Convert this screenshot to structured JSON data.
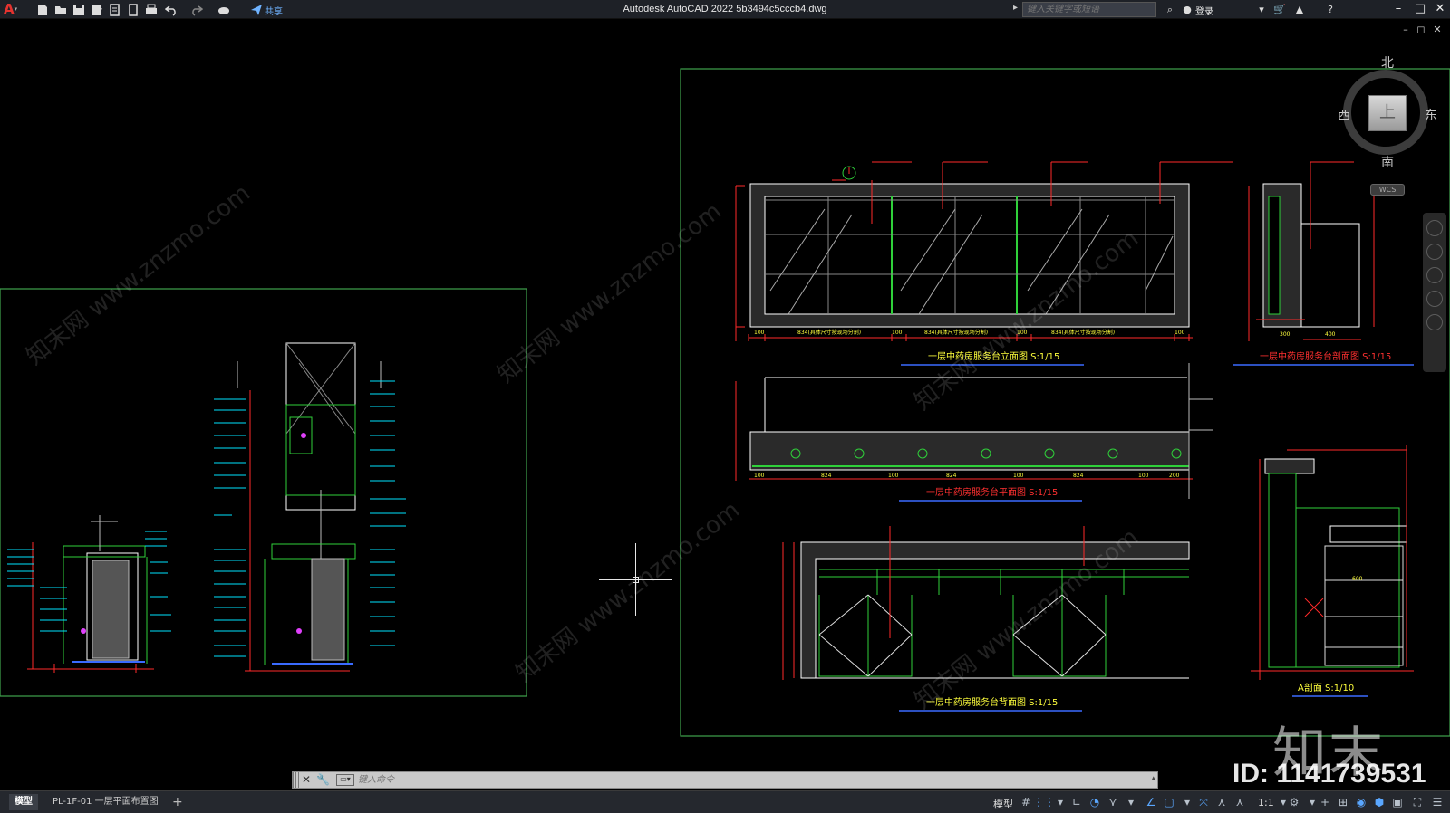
{
  "app": {
    "title": "Autodesk AutoCAD 2022    5b3494c5cccb4.dwg",
    "logo": "A",
    "share_label": "共享",
    "search_placeholder": "键入关键字或短语",
    "login_label": "登录"
  },
  "icons": {
    "qat": [
      "new-icon",
      "open-icon",
      "save-icon",
      "save-as-icon",
      "publish-icon",
      "plot-preview-icon",
      "plot-icon",
      "undo-icon",
      "redo-icon",
      "match-props-icon",
      "share-icon"
    ],
    "right": [
      "search-icon",
      "user-icon",
      "cart-icon",
      "autodesk-app-icon",
      "help-icon"
    ]
  },
  "viewcube": {
    "north": "北",
    "south": "南",
    "west": "西",
    "east": "东",
    "face": "上",
    "wcs": "WCS"
  },
  "drawing": {
    "titles": {
      "front_elevation": "一层中药房服务台立面图  S:1/15",
      "side_section": "一层中药房服务台剖面图  S:1/15",
      "plan": "一层中药房服务台平面图  S:1/15",
      "back_elevation": "一层中药房服务台背面图  S:1/15",
      "detail_a": "A剖面  S:1/10"
    },
    "dims": {
      "front_bottom": [
        "100",
        "834(具体尺寸按现场分割)",
        "100",
        "834(具体尺寸按现场分割)",
        "100",
        "834(具体尺寸按现场分割)",
        "100"
      ],
      "plan_bottom": [
        "100",
        "824",
        "100",
        "824",
        "100",
        "824",
        "100",
        "200"
      ],
      "side_bottom": [
        "300",
        "400"
      ],
      "detail_total": "600"
    },
    "colors": {
      "frame": "#3fa34d",
      "outline": "#ffffff",
      "dim": "#ff2a2a",
      "annotation": "#00e5ff",
      "title_text": "#ffff3c",
      "title_text_red": "#ff3030",
      "underline": "#3a6bff"
    }
  },
  "watermark": {
    "text": "知末网 www.znzmo.com",
    "brand": "知末",
    "id": "ID: 1141739531"
  },
  "commandline": {
    "placeholder": "键入命令"
  },
  "statusbar": {
    "tabs": [
      {
        "label": "模型",
        "active": true
      },
      {
        "label": "PL-1F-01 一层平面布置图",
        "active": false
      }
    ],
    "add_tab": "+",
    "model_label": "模型",
    "scale_label": "1:1"
  }
}
